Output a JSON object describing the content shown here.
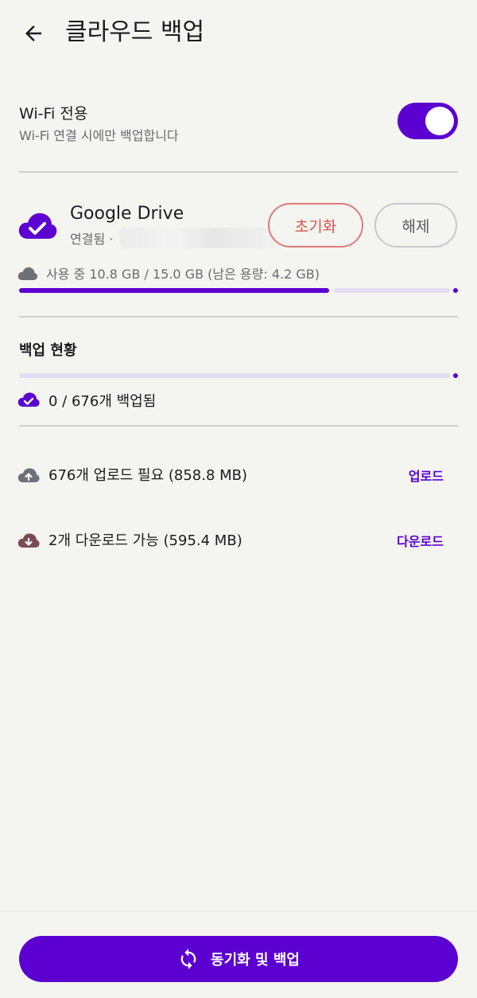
{
  "header": {
    "title": "클라우드 백업"
  },
  "wifi": {
    "title": "Wi-Fi 전용",
    "subtitle": "Wi-Fi 연결 시에만 백업합니다",
    "enabled": true
  },
  "drive": {
    "name": "Google Drive",
    "status": "연결됨 ·",
    "reset_label": "초기화",
    "disconnect_label": "해제"
  },
  "storage": {
    "text": "사용 중 10.8 GB / 15.0 GB (남은 용량: 4.2 GB)",
    "used_gb": 10.8,
    "total_gb": 15.0
  },
  "backup_status": {
    "title": "백업 현황",
    "backed_text": "0 / 676개 백업됨",
    "backed_count": 0,
    "total_count": 676
  },
  "actions": {
    "upload": {
      "text": "676개 업로드 필요 (858.8 MB)",
      "link": "업로드"
    },
    "download": {
      "text": "2개 다운로드 가능 (595.4 MB)",
      "link": "다운로드"
    }
  },
  "footer": {
    "sync_label": "동기화 및 백업"
  },
  "colors": {
    "accent": "#5c00d2",
    "accent_light": "#e5dcf4",
    "danger": "#d9534f",
    "upload_icon": "#6e7078",
    "download_icon": "#7b4a52"
  }
}
